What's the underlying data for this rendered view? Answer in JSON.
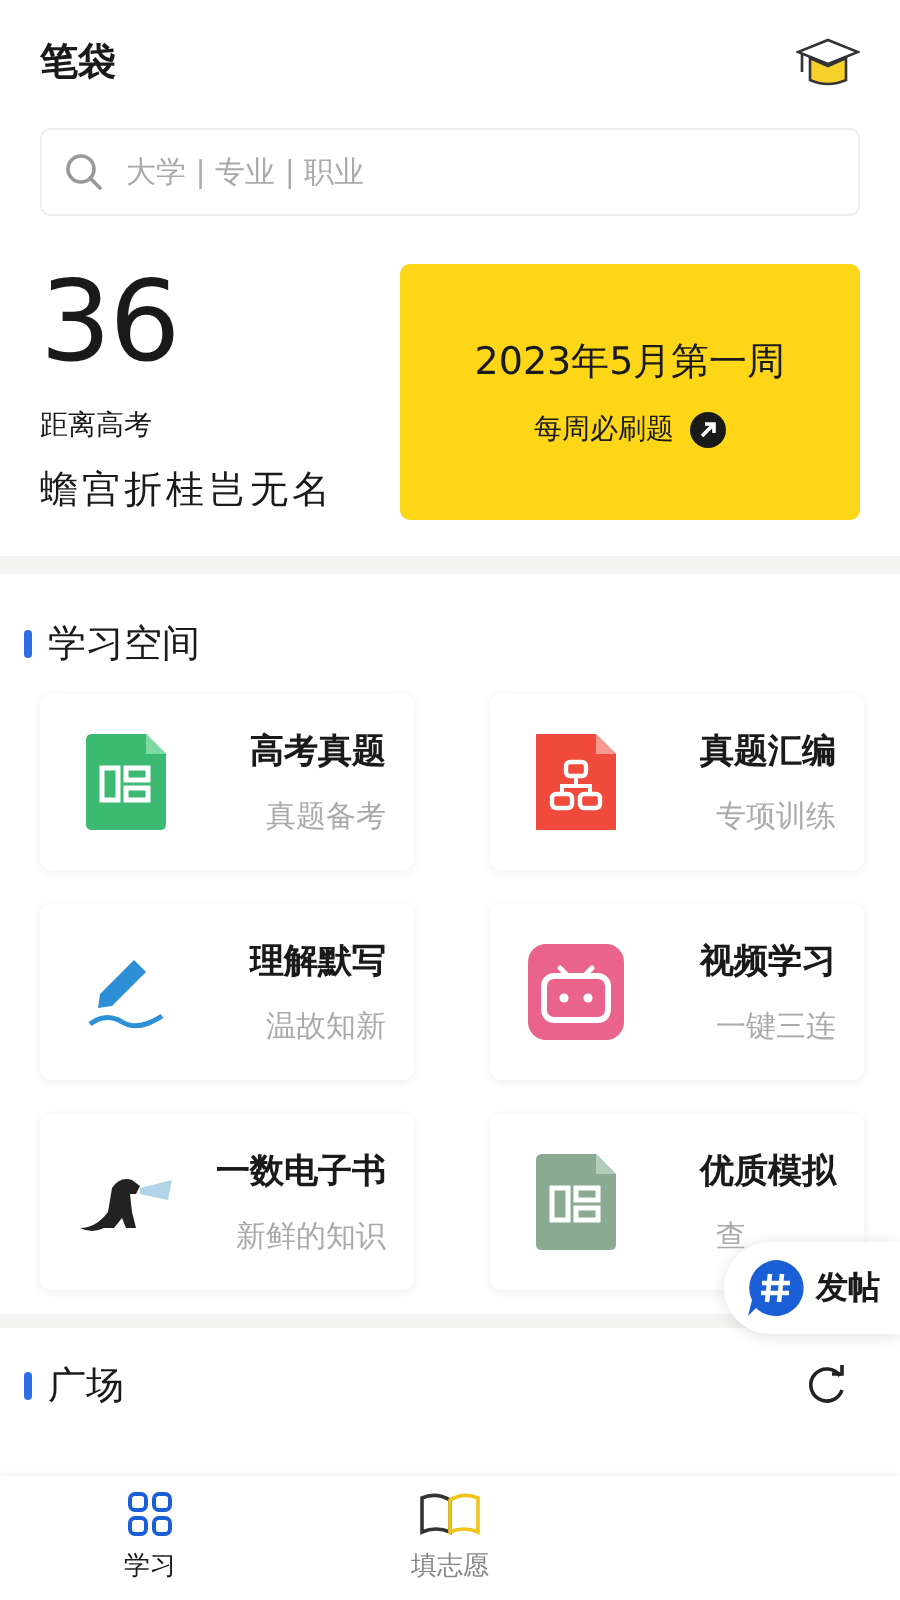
{
  "header": {
    "title": "笔袋"
  },
  "search": {
    "placeholder": "大学 | 专业 | 职业"
  },
  "countdown": {
    "days": "36",
    "label": "距离高考",
    "motto": "蟾宫折桂岂无名"
  },
  "weekly": {
    "title": "2023年5月第一周",
    "link": "每周必刷题"
  },
  "study_space": {
    "title": "学习空间",
    "items": [
      {
        "title": "高考真题",
        "subtitle": "真题备考",
        "kind": "green-doc"
      },
      {
        "title": "真题汇编",
        "subtitle": "专项训练",
        "kind": "red-doc"
      },
      {
        "title": "理解默写",
        "subtitle": "温故知新",
        "kind": "pen"
      },
      {
        "title": "视频学习",
        "subtitle": "一键三连",
        "kind": "tv"
      },
      {
        "title": "一数电子书",
        "subtitle": "新鲜的知识",
        "kind": "dino"
      },
      {
        "title": "优质模拟",
        "subtitle": "查",
        "kind": "grey-doc"
      }
    ]
  },
  "post_button": {
    "label": "发帖"
  },
  "square": {
    "title": "广场"
  },
  "bottom_nav": [
    {
      "label": "学习",
      "selected": true,
      "kind": "grid"
    },
    {
      "label": "填志愿",
      "selected": false,
      "kind": "book"
    }
  ]
}
